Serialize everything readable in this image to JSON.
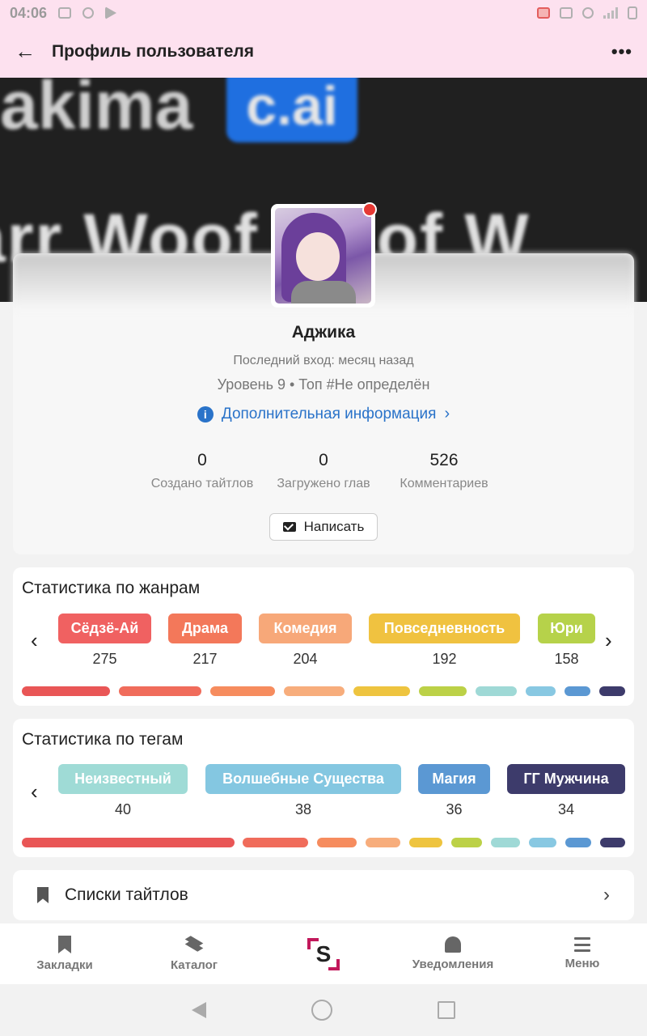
{
  "status_bar": {
    "time": "04:06"
  },
  "app_bar": {
    "back_icon": "arrow-left-icon",
    "title": "Профиль пользователя",
    "more_icon": "more-dots-icon",
    "more_glyph": "•••"
  },
  "banner": {
    "text_top": "akima",
    "badge_text": "c.ai",
    "text_bottom": "arr Woof woof   W"
  },
  "profile": {
    "name": "Аджика",
    "last_login": "Последний вход: месяц назад",
    "level_line": "Уровень 9 • Топ #Не определён",
    "more_info": "Дополнительная информация",
    "online": true,
    "online_color": "#e53935",
    "stats": [
      {
        "value": "0",
        "label": "Создано тайтлов"
      },
      {
        "value": "0",
        "label": "Загружено глав"
      },
      {
        "value": "526",
        "label": "Комментариев"
      }
    ],
    "write_button": "Написать"
  },
  "genres": {
    "title": "Статистика по жанрам",
    "items": [
      {
        "label": "Сёдзё-Ай",
        "count": "275",
        "color": "#f06161"
      },
      {
        "label": "Драма",
        "count": "217",
        "color": "#f3785a"
      },
      {
        "label": "Комедия",
        "count": "204",
        "color": "#f7a879"
      },
      {
        "label": "Повседневность",
        "count": "192",
        "color": "#f0c240"
      },
      {
        "label": "Юри",
        "count": "158",
        "color": "#b6d24a"
      }
    ],
    "bar_colors": [
      "#e95656",
      "#f06c5b",
      "#f68c5e",
      "#f7ad7c",
      "#eec43f",
      "#bcd147",
      "#9fd9d6",
      "#88c8e2",
      "#5b98d3",
      "#3d3b6b"
    ]
  },
  "tags": {
    "title": "Статистика по тегам",
    "items": [
      {
        "label": "Неизвестный",
        "count": "40",
        "color": "#9fdbd6"
      },
      {
        "label": "Волшебные Существа",
        "count": "38",
        "color": "#84c7e1"
      },
      {
        "label": "Магия",
        "count": "36",
        "color": "#5b98d3"
      },
      {
        "label": "ГГ Мужчина",
        "count": "34",
        "color": "#3d3b6b"
      }
    ],
    "bar_colors": [
      "#e95656",
      "#f06c5b",
      "#f68c5e",
      "#f7ad7c",
      "#eec43f",
      "#bcd147",
      "#9fd9d6",
      "#88c8e2",
      "#5b98d3",
      "#3d3b6b"
    ]
  },
  "lists": {
    "label": "Списки тайтлов"
  },
  "bottom_nav": [
    {
      "label": "Закладки"
    },
    {
      "label": "Каталог"
    },
    {
      "label": ""
    },
    {
      "label": "Уведомления"
    },
    {
      "label": "Меню"
    }
  ]
}
